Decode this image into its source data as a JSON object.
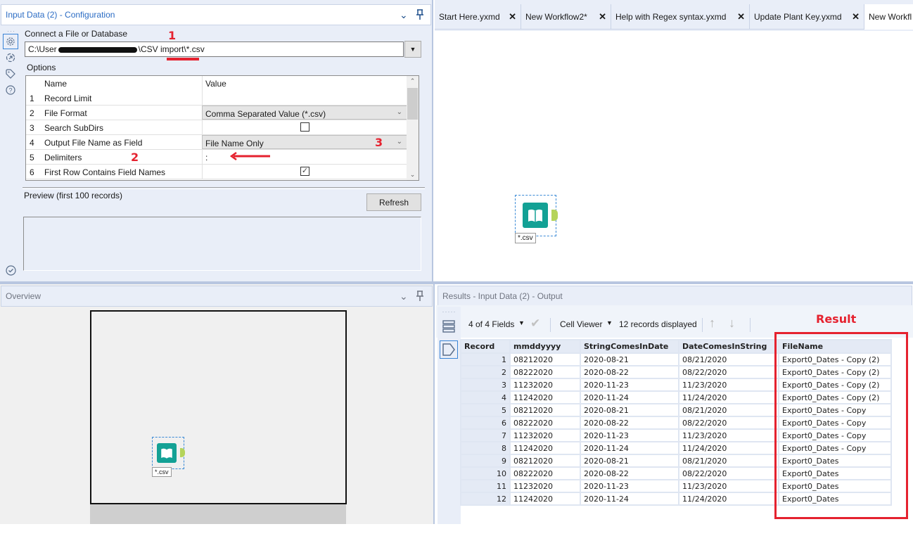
{
  "config_panel": {
    "title": "Input Data (2) - Configuration",
    "connect_label": "Connect a File or Database",
    "path_prefix": "C:\\User",
    "path_suffix": "\\CSV import\\*.csv",
    "options_label": "Options",
    "grid_headers": {
      "name": "Name",
      "value": "Value"
    },
    "options": [
      {
        "num": "1",
        "name": "Record Limit",
        "value": "",
        "type": "text"
      },
      {
        "num": "2",
        "name": "File Format",
        "value": "Comma Separated Value (*.csv)",
        "type": "combo"
      },
      {
        "num": "3",
        "name": "Search SubDirs",
        "value": false,
        "type": "checkbox"
      },
      {
        "num": "4",
        "name": "Output File Name as Field",
        "value": "File Name Only",
        "type": "combo"
      },
      {
        "num": "5",
        "name": "Delimiters",
        "value": ":",
        "type": "text"
      },
      {
        "num": "6",
        "name": "First Row Contains Field Names",
        "value": true,
        "type": "checkbox"
      }
    ],
    "preview_label": "Preview (first 100 records)",
    "refresh_label": "Refresh",
    "side_icons": [
      "gear-icon",
      "navigate-icon",
      "tag-icon",
      "help-icon"
    ]
  },
  "annotations": {
    "note1": "1",
    "note2": "2",
    "note3": "3",
    "result_label": "Result",
    "color": "#e5222f"
  },
  "tabs": [
    {
      "label": "Start Here.yxmd",
      "active": false
    },
    {
      "label": "New Workflow2*",
      "active": false
    },
    {
      "label": "Help with Regex syntax.yxmd",
      "active": false
    },
    {
      "label": "Update Plant Key.yxmd",
      "active": false
    },
    {
      "label": "New Workfl",
      "active": true
    }
  ],
  "canvas": {
    "tool_label": "*.csv",
    "tool_color": "#13a195",
    "anchor_color": "#b5d45a"
  },
  "overview": {
    "title": "Overview"
  },
  "results": {
    "title": "Results - Input Data (2) - Output",
    "fields_label": "4 of 4 Fields",
    "cell_viewer_label": "Cell Viewer",
    "records_label": "12 records displayed",
    "columns": [
      "Record",
      "mmddyyyy",
      "StringComesInDate",
      "DateComesInString",
      "FileName"
    ],
    "rows": [
      [
        "1",
        "08212020",
        "2020-08-21",
        "08/21/2020",
        "Export0_Dates - Copy (2)"
      ],
      [
        "2",
        "08222020",
        "2020-08-22",
        "08/22/2020",
        "Export0_Dates - Copy (2)"
      ],
      [
        "3",
        "11232020",
        "2020-11-23",
        "11/23/2020",
        "Export0_Dates - Copy (2)"
      ],
      [
        "4",
        "11242020",
        "2020-11-24",
        "11/24/2020",
        "Export0_Dates - Copy (2)"
      ],
      [
        "5",
        "08212020",
        "2020-08-21",
        "08/21/2020",
        "Export0_Dates - Copy"
      ],
      [
        "6",
        "08222020",
        "2020-08-22",
        "08/22/2020",
        "Export0_Dates - Copy"
      ],
      [
        "7",
        "11232020",
        "2020-11-23",
        "11/23/2020",
        "Export0_Dates - Copy"
      ],
      [
        "8",
        "11242020",
        "2020-11-24",
        "11/24/2020",
        "Export0_Dates - Copy"
      ],
      [
        "9",
        "08212020",
        "2020-08-21",
        "08/21/2020",
        "Export0_Dates"
      ],
      [
        "10",
        "08222020",
        "2020-08-22",
        "08/22/2020",
        "Export0_Dates"
      ],
      [
        "11",
        "11232020",
        "2020-11-23",
        "11/23/2020",
        "Export0_Dates"
      ],
      [
        "12",
        "11242020",
        "2020-11-24",
        "11/24/2020",
        "Export0_Dates"
      ]
    ]
  }
}
